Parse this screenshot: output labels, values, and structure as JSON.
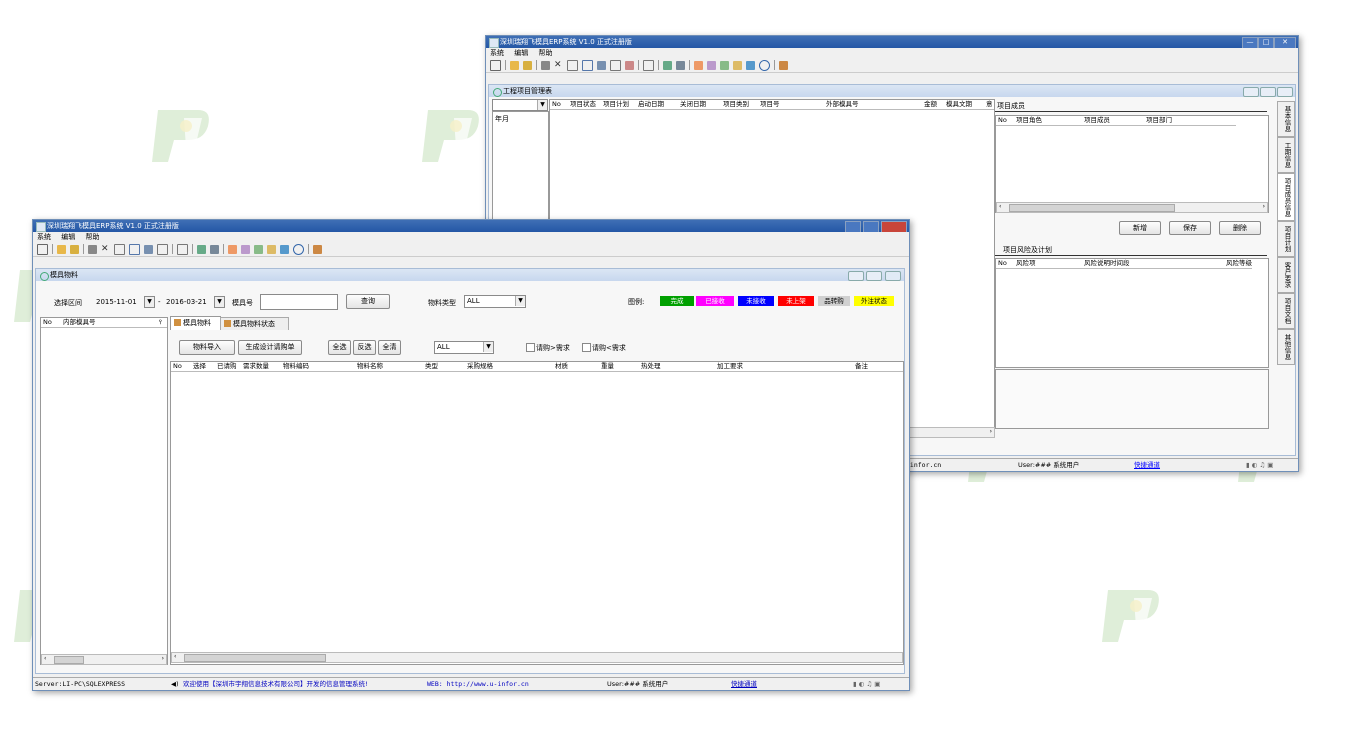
{
  "back_window": {
    "title": "深圳瑞翔飞模具ERP系统 V1.0 正式注册版",
    "menu": [
      "系统",
      "编辑",
      "帮助"
    ],
    "controls": {
      "min": "—",
      "max": "□",
      "close": "✕"
    },
    "child": {
      "title": "工程项目管理表",
      "left_label": "年月",
      "columns": [
        "No",
        "项目状态",
        "项目计划",
        "启动日期",
        "关闭日期",
        "项目类别",
        "项目号",
        "外部模具号",
        "金额",
        "模具文期",
        "意"
      ],
      "members": {
        "title": "项目成员",
        "columns": [
          "No",
          "项目角色",
          "项目成员",
          "项目部门"
        ],
        "buttons": {
          "new": "新增",
          "save": "保存",
          "delete": "删除"
        }
      },
      "risk": {
        "title": "项目风险及计划",
        "columns": [
          "No",
          "风险项",
          "风险说明时间段",
          "风险等级"
        ]
      },
      "side_tabs": [
        "基本信息",
        "工期信息",
        "项目成员信息",
        "项目计划",
        "客户要求",
        "项目文档",
        "其他信息"
      ]
    },
    "status": {
      "site_tail": "rinfor.cn",
      "user": "User:### 系统用户",
      "quick": "快捷通道"
    }
  },
  "front_window": {
    "title": "深圳瑞翔飞模具ERP系统 V1.0 正式注册版",
    "menu": [
      "系统",
      "编辑",
      "帮助"
    ],
    "child": {
      "title": "模具物料",
      "filter": {
        "range_label": "选择区间",
        "date_from": "2015-11-01",
        "dash": "-",
        "date_to": "2016-03-21",
        "mold_no_label": "模具号",
        "query": "查询",
        "material_type_label": "物料类型",
        "material_type_value": "ALL"
      },
      "legend_label": "图例:",
      "legend": [
        {
          "label": "完成",
          "color": "#00a000",
          "text_color": "#ffffff"
        },
        {
          "label": "已接收",
          "color": "#ff00ff",
          "text_color": "#ffffff"
        },
        {
          "label": "未接收",
          "color": "#0000ff",
          "text_color": "#ffffff"
        },
        {
          "label": "未上架",
          "color": "#ff0000",
          "text_color": "#ffffff"
        },
        {
          "label": "品转购",
          "color": "#d0d0d0",
          "text_color": "#000000"
        },
        {
          "label": "外注状态",
          "color": "#ffff00",
          "text_color": "#000000"
        }
      ],
      "left_tree": {
        "no": "No",
        "header": "内部模具号"
      },
      "tabs": [
        "模具物料",
        "模具物料状态"
      ],
      "actions": {
        "import": "物料导入",
        "generate": "生成设计请购单",
        "select_all": "全选",
        "invert": "反选",
        "clear": "全清",
        "filter_value": "ALL",
        "check1": "请购>需求",
        "check2": "请购<需求"
      },
      "columns": [
        "No",
        "选择",
        "已请购",
        "需求数量",
        "物料编码",
        "物料名称",
        "类型",
        "采购规格",
        "材质",
        "重量",
        "热处理",
        "加工要求",
        "备注"
      ]
    },
    "status": {
      "server": "Server:LI-PC\\SQLEXPRESS",
      "welcome": "欢迎使用【深圳市宇翔信息技术有限公司】开发的信息管理系统!",
      "web": "WEB: http://www.u-infor.cn",
      "user": "User:### 系统用户",
      "quick": "快捷通道"
    }
  },
  "colors": {
    "title": "#2457a6",
    "watermark": "#d7ead0"
  }
}
